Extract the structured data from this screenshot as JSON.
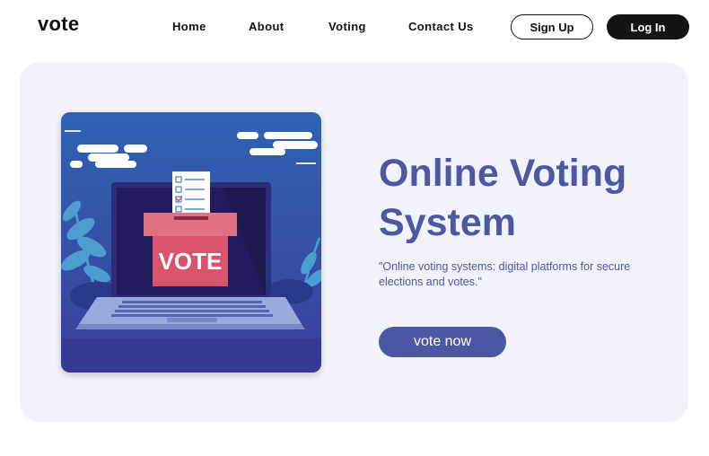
{
  "brand": {
    "logo": "vote"
  },
  "nav": {
    "links": [
      "Home",
      "About",
      "Voting",
      "Contact Us"
    ],
    "signup_label": "Sign Up",
    "login_label": "Log In"
  },
  "hero": {
    "title": "Online Voting System",
    "description": "\"Online voting systems: digital platforms for secure elections and votes.\"",
    "cta_label": "vote now",
    "illustration": {
      "icon": "ballot-box-laptop-illustration",
      "ballot_box_text": "VOTE"
    }
  },
  "colors": {
    "accent": "#4d58a3",
    "hero_bg": "#f2f2fa",
    "dark": "#141414",
    "ballot_box": "#d9546b"
  }
}
